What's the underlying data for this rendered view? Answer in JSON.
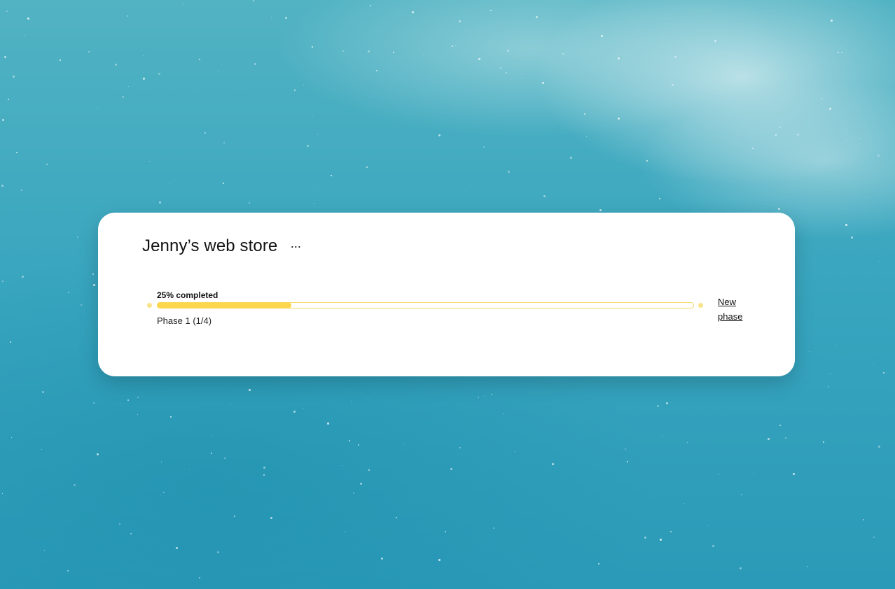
{
  "project": {
    "title": "Jenny’s web store",
    "more_icon": "ellipsis-icon",
    "more_glyph": "···"
  },
  "progress": {
    "percent_label": "25% completed",
    "fraction": 0.25,
    "phase_label": "Phase 1 (1/4)",
    "new_phase_label": "New phase"
  },
  "colors": {
    "progress_fill": "#fcd64c",
    "progress_border": "#f2d868",
    "card_background": "#ffffff"
  }
}
